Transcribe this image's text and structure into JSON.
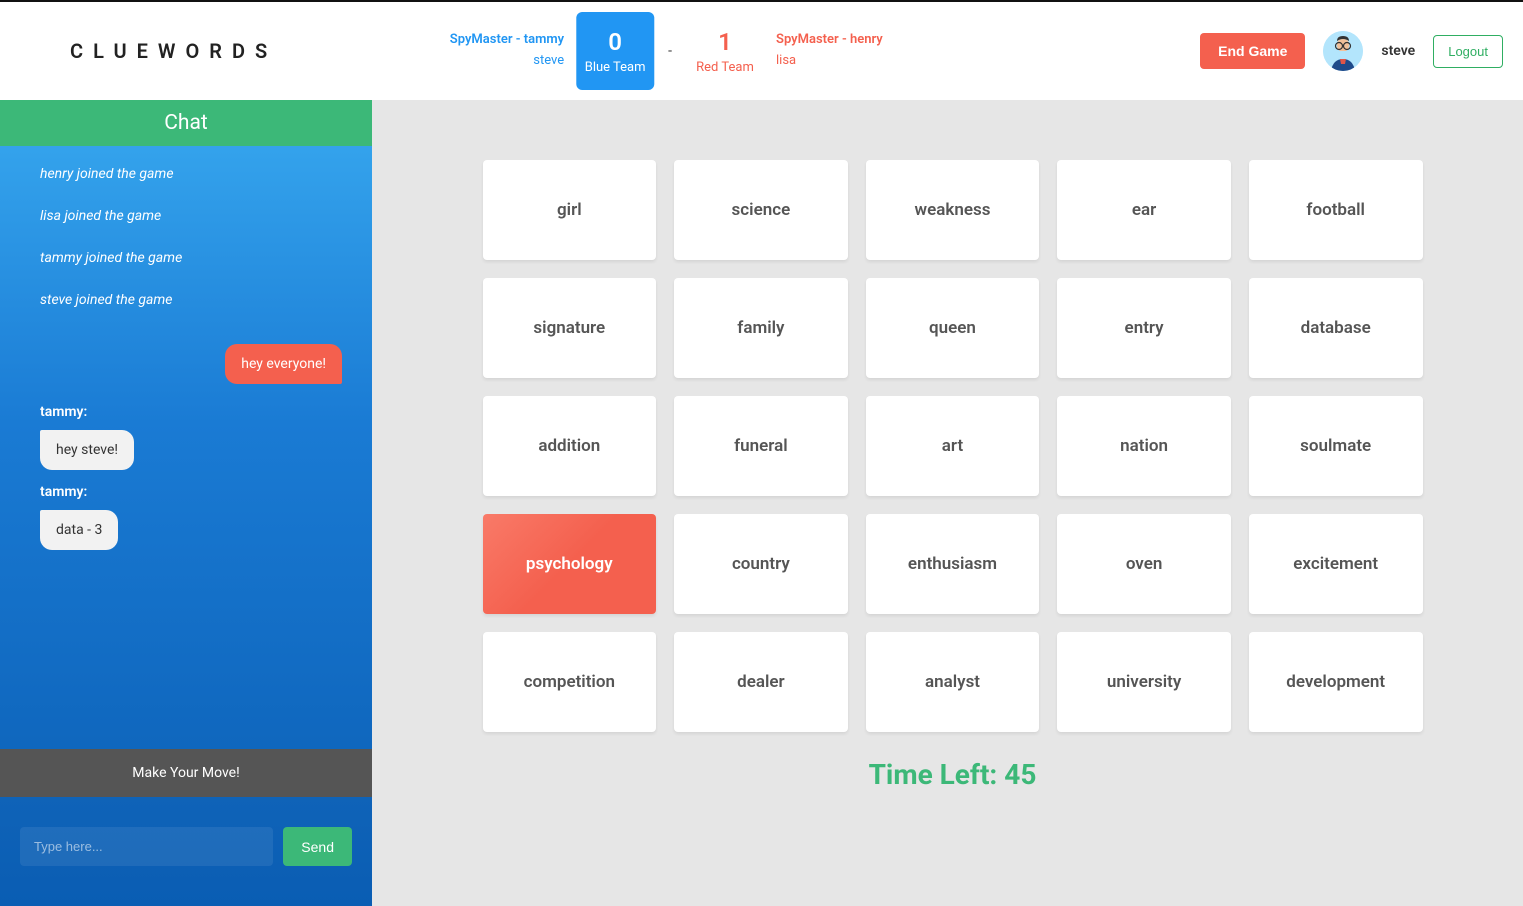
{
  "app": {
    "title": "CLUEWORDS"
  },
  "header": {
    "blue": {
      "spymaster_label": "SpyMaster - tammy",
      "player": "steve",
      "score": "0",
      "team_label": "Blue Team"
    },
    "red": {
      "spymaster_label": "SpyMaster - henry",
      "player": "lisa",
      "score": "1",
      "team_label": "Red Team"
    },
    "separator": "-",
    "end_game": "End Game",
    "username": "steve",
    "logout": "Logout"
  },
  "chat": {
    "header": "Chat",
    "system": [
      "henry joined the game",
      "lisa joined the game",
      "tammy joined the game",
      "steve joined the game"
    ],
    "own_message": "hey everyone!",
    "messages": [
      {
        "sender": "tammy:",
        "text": "hey steve!"
      },
      {
        "sender": "tammy:",
        "text": "data - 3"
      }
    ],
    "banner": "Make Your Move!",
    "input_placeholder": "Type here...",
    "send": "Send"
  },
  "board": {
    "cards": [
      {
        "word": "girl",
        "state": "neutral"
      },
      {
        "word": "science",
        "state": "neutral"
      },
      {
        "word": "weakness",
        "state": "neutral"
      },
      {
        "word": "ear",
        "state": "neutral"
      },
      {
        "word": "football",
        "state": "neutral"
      },
      {
        "word": "signature",
        "state": "neutral"
      },
      {
        "word": "family",
        "state": "neutral"
      },
      {
        "word": "queen",
        "state": "neutral"
      },
      {
        "word": "entry",
        "state": "neutral"
      },
      {
        "word": "database",
        "state": "neutral"
      },
      {
        "word": "addition",
        "state": "neutral"
      },
      {
        "word": "funeral",
        "state": "neutral"
      },
      {
        "word": "art",
        "state": "neutral"
      },
      {
        "word": "nation",
        "state": "neutral"
      },
      {
        "word": "soulmate",
        "state": "neutral"
      },
      {
        "word": "psychology",
        "state": "red"
      },
      {
        "word": "country",
        "state": "neutral"
      },
      {
        "word": "enthusiasm",
        "state": "neutral"
      },
      {
        "word": "oven",
        "state": "neutral"
      },
      {
        "word": "excitement",
        "state": "neutral"
      },
      {
        "word": "competition",
        "state": "neutral"
      },
      {
        "word": "dealer",
        "state": "neutral"
      },
      {
        "word": "analyst",
        "state": "neutral"
      },
      {
        "word": "university",
        "state": "neutral"
      },
      {
        "word": "development",
        "state": "neutral"
      }
    ],
    "timer_label": "Time Left: ",
    "timer_value": "45"
  }
}
